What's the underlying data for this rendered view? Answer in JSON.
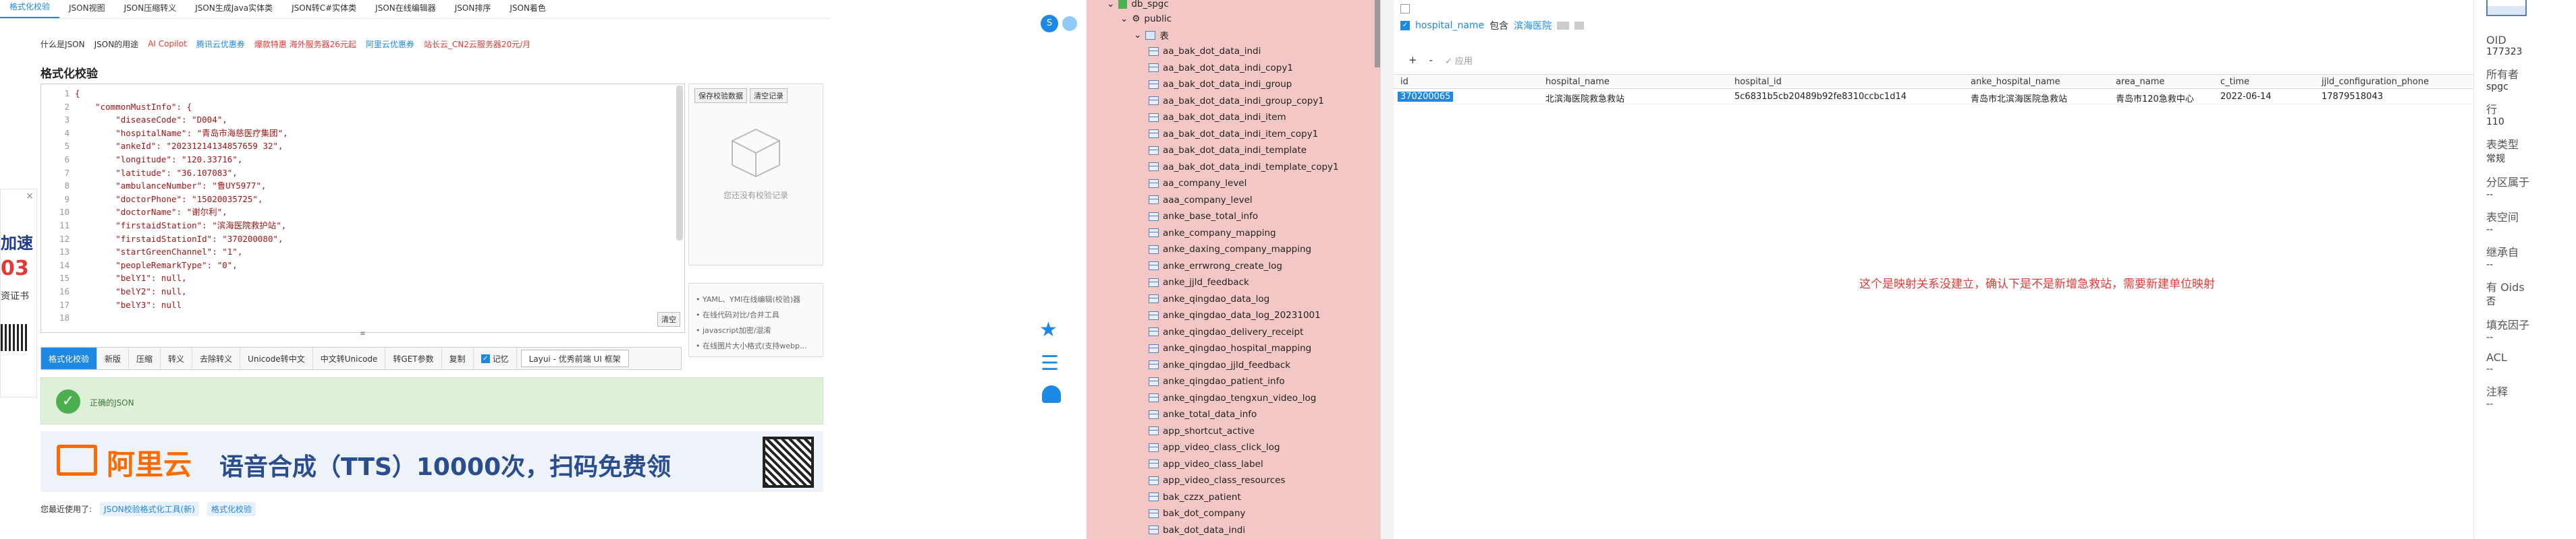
{
  "nav": {
    "tabs": [
      "格式化校验",
      "JSON视图",
      "JSON压缩转义",
      "JSON生成Java实体类",
      "JSON转C#实体类",
      "JSON在线编辑器",
      "JSON排序",
      "JSON着色"
    ],
    "active_index": 0
  },
  "links": [
    {
      "text": "什么是JSON",
      "color": "#333333"
    },
    {
      "text": "JSON的用途",
      "color": "#333333"
    },
    {
      "text": "AI Copilot",
      "color": "#e53935"
    },
    {
      "text": "腾讯云优惠券",
      "color": "#1e88e5"
    },
    {
      "text": "爆款特惠 海外服务器26元起",
      "color": "#e53935"
    },
    {
      "text": "阿里云优惠券",
      "color": "#1e88e5"
    },
    {
      "text": "站长云_CN2云服务器20元/月",
      "color": "#e53935"
    }
  ],
  "page_title": "格式化校验",
  "editor": {
    "line_numbers": [
      "1",
      "2",
      "3",
      "4",
      "5",
      "6",
      "7",
      "8",
      "9",
      "10",
      "11",
      "12",
      "13",
      "14",
      "15",
      "16",
      "17",
      "18"
    ],
    "code_lines": [
      "{",
      "    \"commonMustInfo\": {",
      "        \"diseaseCode\": \"D004\",",
      "        \"hospitalName\": \"青岛市海慈医疗集团\",",
      "        \"ankeId\": \"20231214134857659 32\",",
      "        \"longitude\": \"120.33716\",",
      "        \"latitude\": \"36.107083\",",
      "        \"ambulanceNumber\": \"鲁UY5977\",",
      "        \"doctorPhone\": \"15020035725\",",
      "        \"doctorName\": \"谢尔利\",",
      "        \"firstaidStation\": \"滨海医院救护站\",",
      "        \"firstaidStationId\": \"370200080\",",
      "        \"startGreenChannel\": \"1\",",
      "        \"peopleRemarkType\": \"0\",",
      "        \"belY1\": null,",
      "        \"belY2\": null,",
      "        \"belY3\": null",
      ""
    ],
    "resize_glyph": "≡"
  },
  "right_panel": {
    "save_btn": "保存校验数据",
    "clear_btn": "清空记录",
    "empty_text": "您还没有校验记录"
  },
  "tips": [
    "YAML、YMI在线编辑(校验)器",
    "在线代码对比/合并工具",
    "javascript加密/混淆",
    "在线图片大小格式(支持webp..."
  ],
  "clear_editor_btn": "清空",
  "toolbar": {
    "buttons": [
      "格式化校验",
      "新版",
      "压缩",
      "转义",
      "去除转义",
      "Unicode转中文",
      "中文转Unicode",
      "转GET参数",
      "复制"
    ],
    "remember_label": "记忆",
    "layui_btn": "Layui - 优秀前端 UI 框架"
  },
  "result_text": "正确的JSON",
  "ad": {
    "brand": "阿里云",
    "text": "语音合成（TTS）10000次，扫码免费领"
  },
  "footer": {
    "label": "您最近使用了:",
    "chips": [
      "JSON校验格式化工具(新)",
      "格式化校验"
    ]
  },
  "left_strip": {
    "lines": [
      "加速",
      "03",
      "资证书"
    ]
  },
  "mid_icons": [
    "star-icon",
    "menu-icon",
    "bell-icon"
  ],
  "tree": {
    "db": "db_spgc",
    "schema": "public",
    "table_group": "表",
    "tables": [
      "aa_bak_dot_data_indi",
      "aa_bak_dot_data_indi_copy1",
      "aa_bak_dot_data_indi_group",
      "aa_bak_dot_data_indi_group_copy1",
      "aa_bak_dot_data_indi_item",
      "aa_bak_dot_data_indi_item_copy1",
      "aa_bak_dot_data_indi_template",
      "aa_bak_dot_data_indi_template_copy1",
      "aa_company_level",
      "aaa_company_level",
      "anke_base_total_info",
      "anke_company_mapping",
      "anke_daxing_company_mapping",
      "anke_errwrong_create_log",
      "anke_jjld_feedback",
      "anke_qingdao_data_log",
      "anke_qingdao_data_log_20231001",
      "anke_qingdao_delivery_receipt",
      "anke_qingdao_hospital_mapping",
      "anke_qingdao_jjld_feedback",
      "anke_qingdao_patient_info",
      "anke_qingdao_tengxun_video_log",
      "anke_total_data_info",
      "app_shortcut_active",
      "app_video_class_click_log",
      "app_video_class_label",
      "app_video_class_resources",
      "bak_czzx_patient",
      "bak_dot_company",
      "bak_dot_data_indi",
      "bak_dot_data_indi_group"
    ]
  },
  "filter": {
    "field": "hospital_name",
    "op": "包含",
    "value": "滨海医院"
  },
  "grid": {
    "add_btn": "+",
    "del_btn": "-",
    "apply_label": "✓ 应用",
    "columns": [
      "id",
      "hospital_name",
      "hospital_id",
      "anke_hospital_name",
      "area_name",
      "c_time",
      "jjld_configuration_phone"
    ],
    "rows": [
      [
        "370200065",
        "北滨海医院救急救站",
        "5c6831b5cb20489b92fe8310ccbc1d14",
        "青岛市北滨海医院急救站",
        "青岛市120急救中心",
        "2022-06-14",
        "17879518043"
      ]
    ],
    "annotation": "这个是映射关系没建立，确认下是不是新增急救站，需要新建单位映射",
    "annotation_color": "#e53935"
  },
  "props": [
    {
      "label": "OID",
      "value": "177323"
    },
    {
      "label": "所有者",
      "value": "spgc"
    },
    {
      "label": "行",
      "value": "110"
    },
    {
      "label": "表类型",
      "value": "常规"
    },
    {
      "label": "分区属于",
      "value": "--"
    },
    {
      "label": "表空间",
      "value": "--"
    },
    {
      "label": "继承自",
      "value": "--"
    },
    {
      "label": "有 Oids",
      "value": "否"
    },
    {
      "label": "填充因子",
      "value": "--"
    },
    {
      "label": "ACL",
      "value": "--"
    },
    {
      "label": "注释",
      "value": "--"
    }
  ]
}
